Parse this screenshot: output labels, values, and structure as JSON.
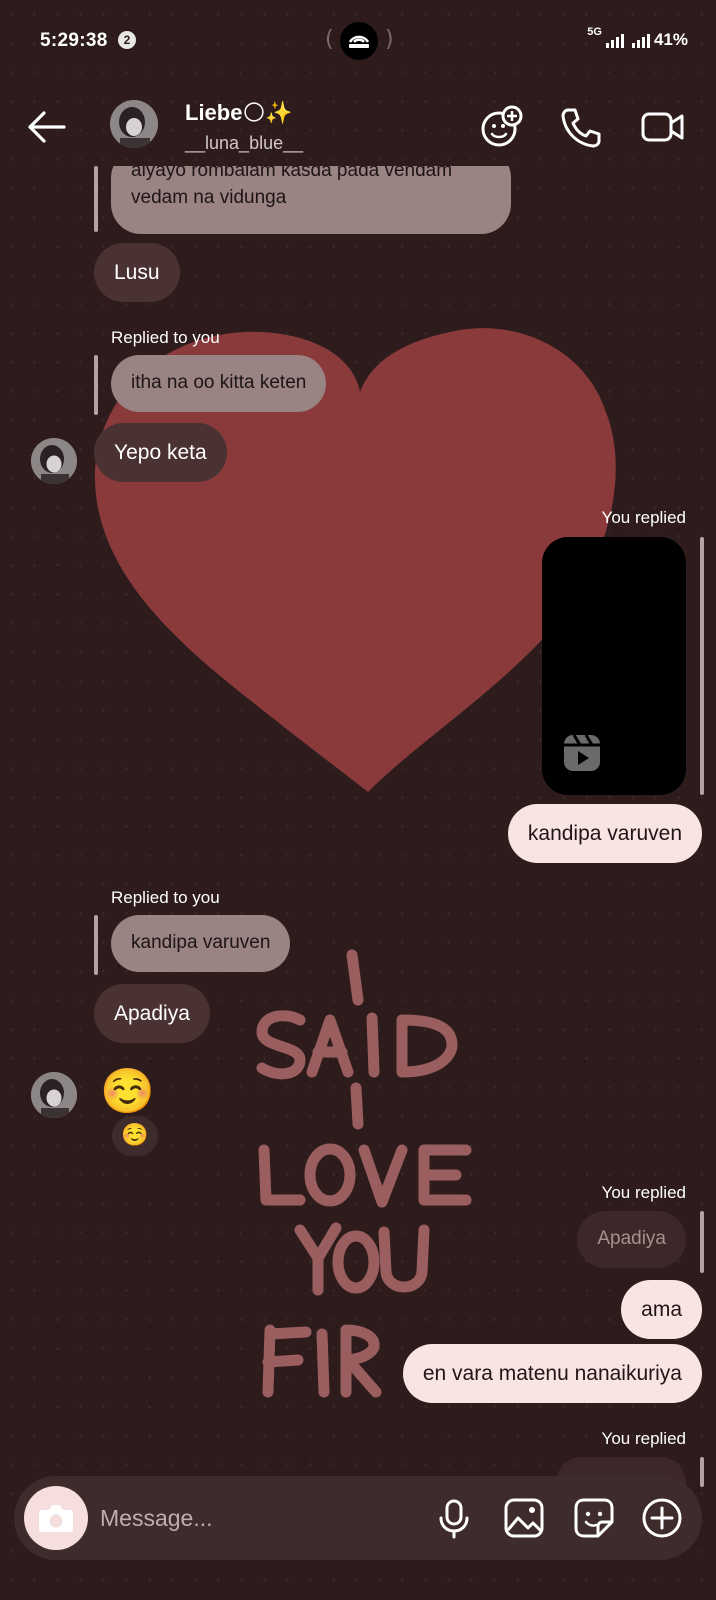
{
  "status_bar": {
    "time": "5:29:38",
    "notification_count": "2",
    "network": "5G",
    "battery": "41%"
  },
  "header": {
    "name": "Liebe🌕✨",
    "username": "__luna_blue__"
  },
  "messages": {
    "partial_quote": "aiyayo rombalam kasda pada vendam\nvedam na vidunga",
    "m1": "Lusu",
    "replied_to_you_1": "Replied to you",
    "quote_1": "itha na oo kitta keten",
    "m2": "Yepo keta",
    "you_replied_1": "You replied",
    "m3": "kandipa varuven",
    "replied_to_you_2": "Replied to you",
    "quote_2": "kandipa varuven",
    "m4": "Apadiya",
    "emoji_msg": "☺️",
    "emoji_reaction": "☺️",
    "you_replied_2": "You replied",
    "quote_3": "Apadiya",
    "m5": "ama",
    "m6": "en vara matenu nanaikuriya",
    "you_replied_3": "You replied"
  },
  "wallpaper": {
    "lettering": "I SAID I LOVE YOU FIRST",
    "heart_color": "#8b3a3c",
    "text_color": "#9a5e5e"
  },
  "composer": {
    "placeholder": "Message..."
  },
  "colors": {
    "background": "#2e1c1d",
    "incoming_bubble": "#4a3233",
    "outgoing_bubble": "#f8e4e2",
    "quoted_bubble": "#9a8383"
  }
}
